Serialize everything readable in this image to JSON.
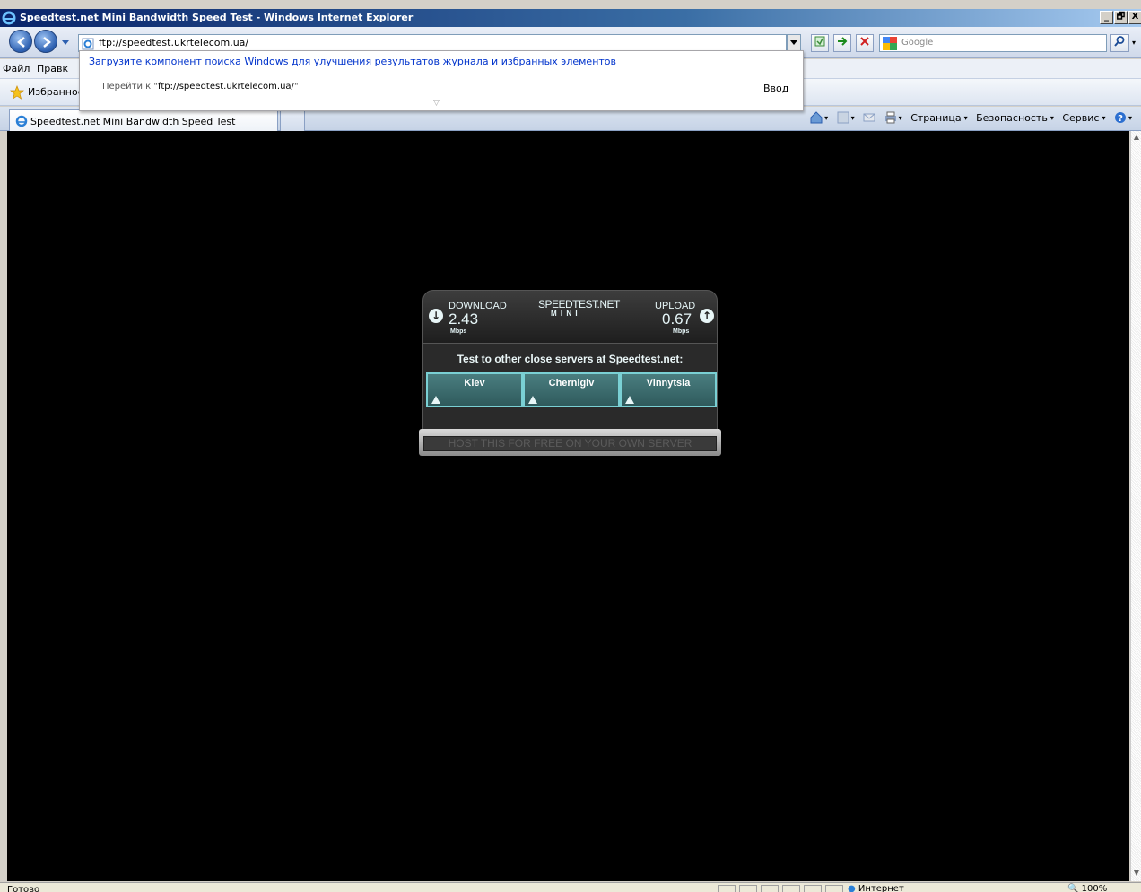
{
  "window": {
    "title": "Speedtest.net Mini Bandwidth Speed Test - Windows Internet Explorer",
    "minimize": "_",
    "maximize": "🗗",
    "close": "X"
  },
  "address": {
    "url": "ftp://speedtest.ukrtelecom.ua/"
  },
  "search": {
    "placeholder": "Google"
  },
  "menu": {
    "file": "Файл",
    "edit": "Правк"
  },
  "favorites": {
    "label": "Избранное"
  },
  "autocomplete": {
    "link": "Загрузите компонент поиска Windows для улучшения результатов журнала и избранных элементов",
    "goto_prefix": "Перейти к \"",
    "goto_url": "ftp://speedtest.ukrtelecom.ua/",
    "goto_suffix": "\"",
    "enter": "Ввод"
  },
  "tab": {
    "title": "Speedtest.net Mini Bandwidth Speed Test"
  },
  "commandbar": {
    "page": "Страница",
    "safety": "Безопасность",
    "tools": "Сервис"
  },
  "speedtest": {
    "logo": "SPEEDTEST.NET",
    "logo_sub": "M I N I",
    "download_label": "DOWNLOAD",
    "download_value": "2.43",
    "download_unit": "Mbps",
    "upload_label": "UPLOAD",
    "upload_value": "0.67",
    "upload_unit": "Mbps",
    "headline": "Test to other close servers at Speedtest.net:",
    "servers": [
      "Kiev",
      "Chernigiv",
      "Vinnytsia"
    ],
    "host_button": "HOST THIS FOR FREE ON YOUR OWN SERVER"
  },
  "status": {
    "text": "Готово",
    "zone": "Интернет",
    "zoom": "100%"
  },
  "colors": {
    "accent": "#7ad0d4",
    "titlebar": "#0a246a"
  }
}
